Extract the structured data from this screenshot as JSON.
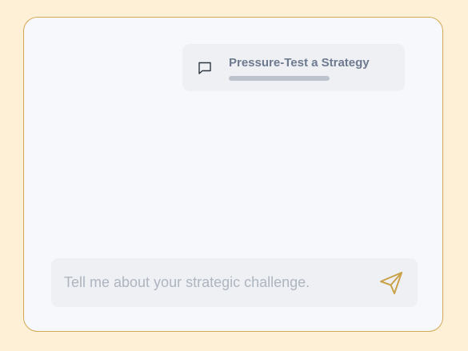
{
  "conversation": {
    "title": "Pressure-Test a Strategy",
    "icon": "chat-bubble-icon",
    "progress": 1.0
  },
  "composer": {
    "placeholder": "Tell me about your strategic challenge.",
    "value": "",
    "send_icon": "send-icon"
  },
  "colors": {
    "background": "#fdf0d7",
    "accent": "#d4a853",
    "panel": "#f6f8fb"
  }
}
